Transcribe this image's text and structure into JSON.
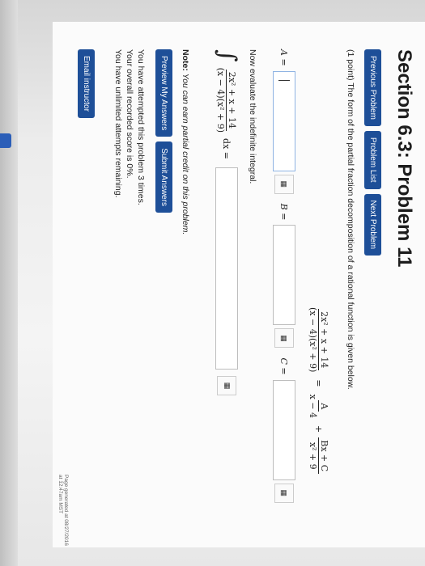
{
  "page": {
    "title": "Section 6.3: Problem 11",
    "nav": [
      "Previous Problem",
      "Problem List",
      "Next Problem"
    ],
    "problem_text": "(1 point) The form of the partial fraction decomposition of a rational function is given below.",
    "equation": {
      "lhs_num": "2x² + x + 14",
      "lhs_den": "(x − 4)(x² + 9)",
      "eq": "=",
      "t1_num": "A",
      "t1_den": "x − 4",
      "plus": "+",
      "t2_num": "Bx + C",
      "t2_den": "x² + 9"
    },
    "labels": {
      "a": "A =",
      "b": "B =",
      "c": "C ="
    },
    "kbd_icon": "keypad-icon",
    "keypad_glyph": "▦",
    "evaluate_text": "Now evaluate the indefinite integral.",
    "integral": {
      "sign": "∫",
      "num": "2x² + x + 14",
      "den": "(x − 4)(x² + 9)",
      "suffix": "dx ="
    },
    "note_label": "Note:",
    "note_text": "You can earn partial credit on this problem.",
    "buttons": {
      "preview": "Preview My Answers",
      "submit": "Submit Answers"
    },
    "status": [
      "You have attempted this problem 3 times.",
      "Your overall recorded score is 0%.",
      "You have unlimited attempts remaining."
    ],
    "email": "Email instructor",
    "footer": "Page generated at 08/27/2016 at 12:47am MST",
    "colors": {
      "button": "#1e4f98",
      "input_focus": "#8fb3e3"
    }
  }
}
